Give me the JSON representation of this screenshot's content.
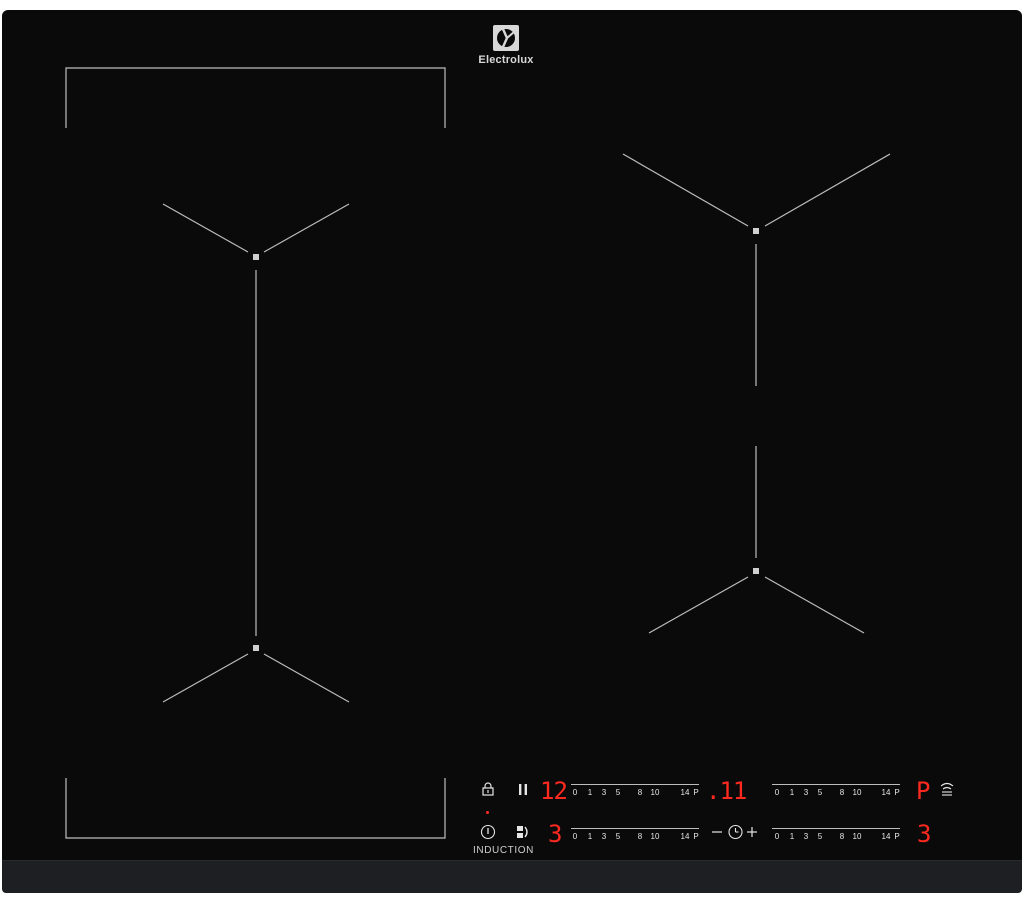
{
  "brand": {
    "name": "Electrolux"
  },
  "colors": {
    "surface": "#0a0a0b",
    "display_red": "#ff2a1f",
    "marking": "#bdbdbd"
  },
  "controls": {
    "induction_label": "INDUCTION",
    "scale_ticks": [
      "0",
      "1",
      "3",
      "5",
      "8",
      "10",
      "14",
      "P"
    ],
    "zones": [
      {
        "id": "front-left-top",
        "display": "12"
      },
      {
        "id": "rear-right",
        "display": ".11"
      },
      {
        "id": "front-left-bottom",
        "display": "3"
      },
      {
        "id": "front-right",
        "display": "3"
      }
    ],
    "right_top_indicator": "P"
  },
  "icons": [
    "electrolux-logo-icon",
    "lock-icon",
    "pause-icon",
    "power-icon",
    "bridge-icon",
    "timer-icon",
    "minus-icon",
    "plus-icon",
    "hob2hood-icon"
  ]
}
